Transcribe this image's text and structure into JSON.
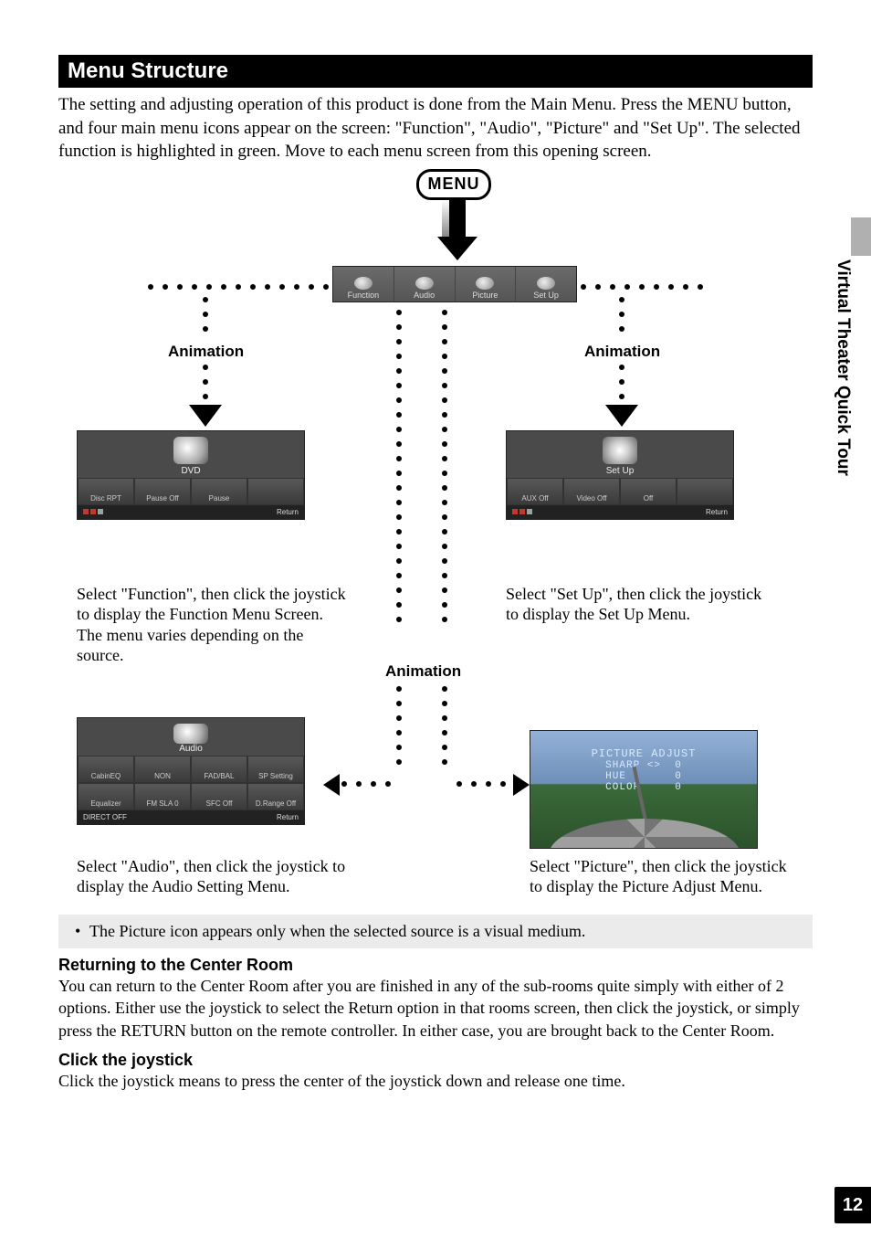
{
  "sidebar": {
    "label": "Virtual Theater Quick Tour"
  },
  "page_number": "12",
  "section": {
    "title": "Menu Structure"
  },
  "intro": "The setting and adjusting operation of this product is done from the Main Menu. Press the MENU button, and four main menu icons appear on the screen: \"Function\", \"Audio\", \"Picture\" and \"Set Up\". The selected function is highlighted in green. Move to each menu screen from this opening screen.",
  "menu_button": {
    "label": "MENU"
  },
  "topbar": {
    "tabs": [
      "Function",
      "Audio",
      "Picture",
      "Set Up"
    ]
  },
  "anim_labels": {
    "left": "Animation",
    "right": "Animation",
    "center": "Animation"
  },
  "screens": {
    "function": {
      "title": "DVD",
      "statuses": [
        "Disc RPT",
        "Pause Off",
        "Pause"
      ],
      "return": "Return"
    },
    "setup": {
      "title": "Set Up",
      "statuses": [
        "AUX Off",
        "Video Off",
        "Off"
      ],
      "return": "Return"
    },
    "audio": {
      "title": "Audio",
      "row1": [
        "CabinEQ",
        "NON",
        "FAD/BAL",
        "SP Setting"
      ],
      "row2": [
        "Equalizer",
        "FM SLA 0",
        "SFC Off",
        "D.Range Off"
      ],
      "direct": "DIRECT OFF",
      "return": "Return"
    },
    "picture": {
      "title": "PICTURE ADJUST",
      "lines": [
        {
          "label": "SHARP",
          "arrows": "<>",
          "value": "0"
        },
        {
          "label": "HUE",
          "arrows": "",
          "value": "0"
        },
        {
          "label": "COLOR",
          "arrows": "",
          "value": "0"
        }
      ]
    }
  },
  "captions": {
    "function": "Select \"Function\", then click the joystick to display the Function Menu Screen. The menu varies depending on the source.",
    "setup": "Select \"Set Up\", then click the joystick to display the Set Up Menu.",
    "audio": "Select \"Audio\", then click the joystick to display the Audio Setting Menu.",
    "picture": "Select \"Picture\", then click the joystick to display the Picture Adjust Menu."
  },
  "note": "The Picture icon appears only when the selected source is a visual medium.",
  "returning": {
    "heading": "Returning to the Center Room",
    "body": "You can return to the Center Room after you are finished in any of the sub-rooms quite simply with either of 2 options. Either use the joystick to select the Return option in that rooms screen, then click the joystick, or simply press the RETURN button on the remote controller. In either case, you are brought back to the Center Room."
  },
  "click": {
    "heading": "Click the joystick",
    "body": "Click the joystick means to press the center of the joystick down and release one time."
  }
}
